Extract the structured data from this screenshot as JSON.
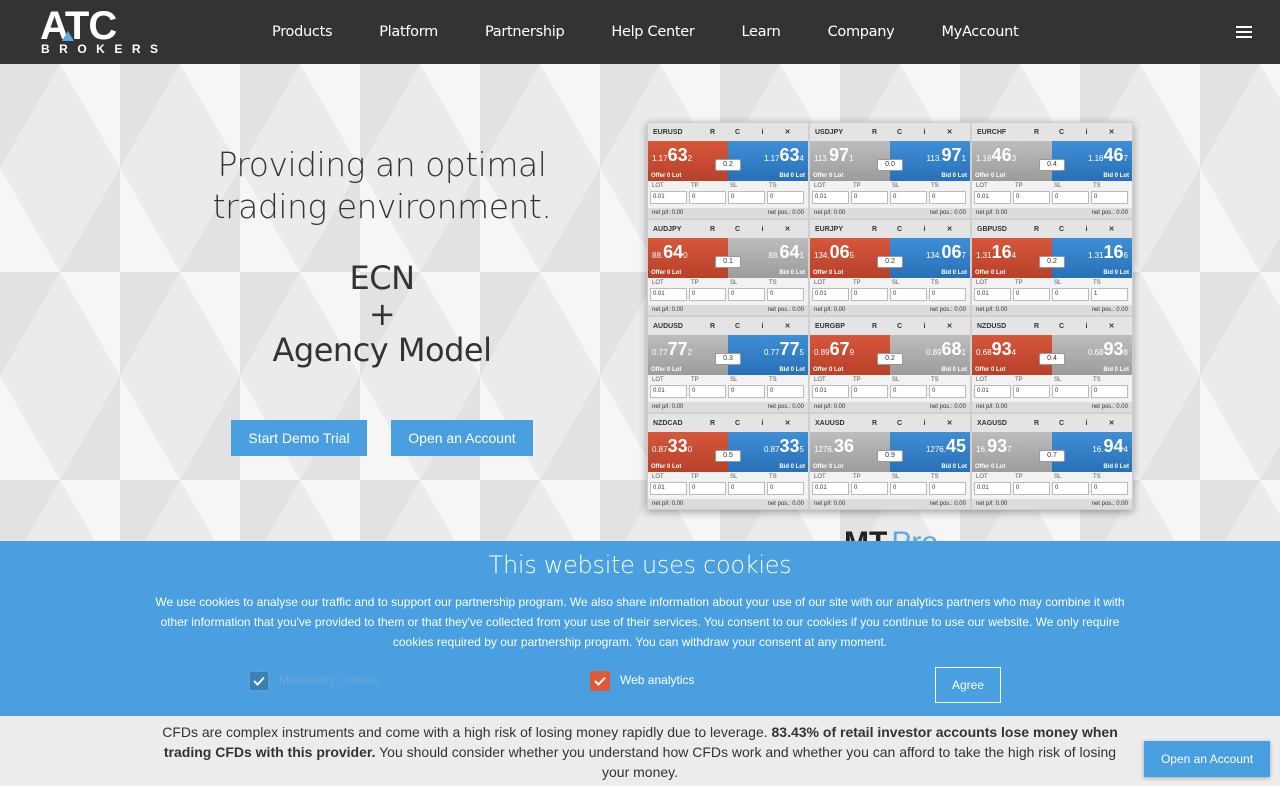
{
  "header": {
    "logo_top": "ATC",
    "logo_bottom": "BROKERS",
    "nav": [
      "Products",
      "Platform",
      "Partnership",
      "Help Center",
      "Learn",
      "Company",
      "MyAccount"
    ]
  },
  "hero": {
    "title": "Providing an optimal trading environment.",
    "sub_line1": "ECN",
    "sub_line2": "+",
    "sub_line3": "Agency Model",
    "demo_button": "Start Demo Trial",
    "open_button": "Open an Account"
  },
  "panel": {
    "tile_buttons": [
      "R",
      "C",
      "i",
      "✕"
    ],
    "offer_label": "Offer  0 Lot",
    "bid_label": "Bid  0 Lot",
    "field_headers": [
      "LOT",
      "TP",
      "SL",
      "TS"
    ],
    "foot_left": "net p/l: 0.00",
    "foot_right": "net pos.: 0.00",
    "tiles": [
      {
        "symbol": "EURUSD",
        "sell_pre": "1.17",
        "sell_big": "63",
        "sell_pip": "2",
        "buy_pre": "1.17",
        "buy_big": "63",
        "buy_pip": "4",
        "spread": "0.2",
        "sell_style": "q-sell",
        "buy_style": "q-buy",
        "fields": [
          "0.01",
          "0",
          "0",
          "0"
        ]
      },
      {
        "symbol": "USDJPY",
        "sell_pre": "113.",
        "sell_big": "97",
        "sell_pip": "1",
        "buy_pre": "113.",
        "buy_big": "97",
        "buy_pip": "1",
        "spread": "0.0",
        "sell_style": "q-grey",
        "buy_style": "q-buy",
        "fields": [
          "0.01",
          "0",
          "0",
          "0"
        ]
      },
      {
        "symbol": "EURCHF",
        "sell_pre": "1.16",
        "sell_big": "46",
        "sell_pip": "3",
        "buy_pre": "1.16",
        "buy_big": "46",
        "buy_pip": "7",
        "spread": "0.4",
        "sell_style": "q-grey",
        "buy_style": "q-buy",
        "fields": [
          "0.01",
          "0",
          "0",
          "0"
        ]
      },
      {
        "symbol": "AUDJPY",
        "sell_pre": "88.",
        "sell_big": "64",
        "sell_pip": "0",
        "buy_pre": "88.",
        "buy_big": "64",
        "buy_pip": "1",
        "spread": "0.1",
        "sell_style": "q-sell",
        "buy_style": "q-grey",
        "fields": [
          "0.01",
          "0",
          "0",
          "0"
        ]
      },
      {
        "symbol": "EURJPY",
        "sell_pre": "134.",
        "sell_big": "06",
        "sell_pip": "5",
        "buy_pre": "134.",
        "buy_big": "06",
        "buy_pip": "7",
        "spread": "0.2",
        "sell_style": "q-sell",
        "buy_style": "q-buy",
        "fields": [
          "0.01",
          "0",
          "0",
          "0"
        ]
      },
      {
        "symbol": "GBPUSD",
        "sell_pre": "1.31",
        "sell_big": "16",
        "sell_pip": "4",
        "buy_pre": "1.31",
        "buy_big": "16",
        "buy_pip": "6",
        "spread": "0.2",
        "sell_style": "q-sell",
        "buy_style": "q-buy",
        "fields": [
          "0.01",
          "0",
          "0",
          "1"
        ]
      },
      {
        "symbol": "AUDUSD",
        "sell_pre": "0.77",
        "sell_big": "77",
        "sell_pip": "2",
        "buy_pre": "0.77",
        "buy_big": "77",
        "buy_pip": "5",
        "spread": "0.3",
        "sell_style": "q-grey",
        "buy_style": "q-buy",
        "fields": [
          "0.01",
          "0",
          "0",
          "0"
        ]
      },
      {
        "symbol": "EURGBP",
        "sell_pre": "0.89",
        "sell_big": "67",
        "sell_pip": "9",
        "buy_pre": "0.89",
        "buy_big": "68",
        "buy_pip": "1",
        "spread": "0.2",
        "sell_style": "q-sell",
        "buy_style": "q-grey",
        "fields": [
          "0.01",
          "0",
          "0",
          "0"
        ]
      },
      {
        "symbol": "NZDUSD",
        "sell_pre": "0.68",
        "sell_big": "93",
        "sell_pip": "4",
        "buy_pre": "0.68",
        "buy_big": "93",
        "buy_pip": "8",
        "spread": "0.4",
        "sell_style": "q-sell",
        "buy_style": "q-grey",
        "fields": [
          "0.01",
          "0",
          "0",
          "0"
        ]
      },
      {
        "symbol": "NZDCAD",
        "sell_pre": "0.87",
        "sell_big": "33",
        "sell_pip": "0",
        "buy_pre": "0.87",
        "buy_big": "33",
        "buy_pip": "5",
        "spread": "0.5",
        "sell_style": "q-sell",
        "buy_style": "q-buy",
        "fields": [
          "0.01",
          "0",
          "0",
          "0"
        ]
      },
      {
        "symbol": "XAUUSD",
        "sell_pre": "1276.",
        "sell_big": "36",
        "sell_pip": "",
        "buy_pre": "1276.",
        "buy_big": "45",
        "buy_pip": "",
        "spread": "0.9",
        "sell_style": "q-grey",
        "buy_style": "q-buy",
        "fields": [
          "0.01",
          "0",
          "0",
          "0"
        ]
      },
      {
        "symbol": "XAGUSD",
        "sell_pre": "16.",
        "sell_big": "93",
        "sell_pip": "7",
        "buy_pre": "16.",
        "buy_big": "94",
        "buy_pip": "4",
        "spread": "0.7",
        "sell_style": "q-grey",
        "buy_style": "q-buy",
        "fields": [
          "0.01",
          "0",
          "0",
          "0"
        ]
      }
    ]
  },
  "mt_logo": {
    "main": "MT",
    "accent": "Pro"
  },
  "cookie": {
    "title": "This website uses cookies",
    "text": "We use cookies to analyse our traffic and to support our partnership program. We also share information about your use of our site with our analytics partners who may combine it with other information that you've provided to them or that they've collected from your use of their services. You consent to our cookies if you continue to use our website. We only require cookies required by our partnership program. You can withdraw your consent at any moment.",
    "mandatory_label": "Mandatory cookies",
    "analytics_label": "Web analytics",
    "agree_button": "Agree"
  },
  "risk": {
    "text_plain": "CFDs are complex instruments and come with a high risk of losing money rapidly due to leverage. ",
    "text_bold": "83.43% of retail investor accounts lose money when trading CFDs with this provider.",
    "text_tail": " You should consider whether you understand how CFDs work and whether you can afford to take the high risk of losing your money.",
    "open_button": "Open an Account"
  }
}
